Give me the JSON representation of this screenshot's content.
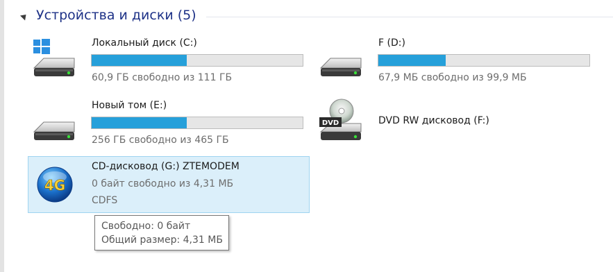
{
  "group": {
    "title": "Устройства и диски (5)"
  },
  "drives": {
    "c": {
      "name": "Локальный диск (C:)",
      "free_text": "60,9 ГБ свободно из 111 ГБ",
      "used_fraction": 0.45,
      "icon": "windows-hdd-icon"
    },
    "d": {
      "name": "F (D:)",
      "free_text": "67,9 МБ свободно из 99,9 МБ",
      "used_fraction": 0.32,
      "icon": "hdd-icon"
    },
    "e": {
      "name": "Новый том (E:)",
      "free_text": "256 ГБ свободно из 465 ГБ",
      "used_fraction": 0.45,
      "icon": "hdd-icon"
    },
    "f": {
      "name": "DVD RW дисковод (F:)",
      "icon": "dvd-drive-icon",
      "icon_label": "DVD"
    },
    "g": {
      "name": "CD-дисковод (G:) ZTEMODEM",
      "free_text": "0 байт свободно из 4,31 МБ",
      "filesystem": "CDFS",
      "icon": "4g-modem-icon",
      "icon_label": "4G"
    }
  },
  "tooltip": {
    "free": "Свободно: 0 байт",
    "total": "Общий размер: 4,31 МБ"
  },
  "colors": {
    "bar_fill": "#26a0da",
    "bar_track": "#e6e6e6",
    "header_text": "#1e3287",
    "selection_bg": "#dbeffa",
    "selection_border": "#9fd4f0"
  }
}
